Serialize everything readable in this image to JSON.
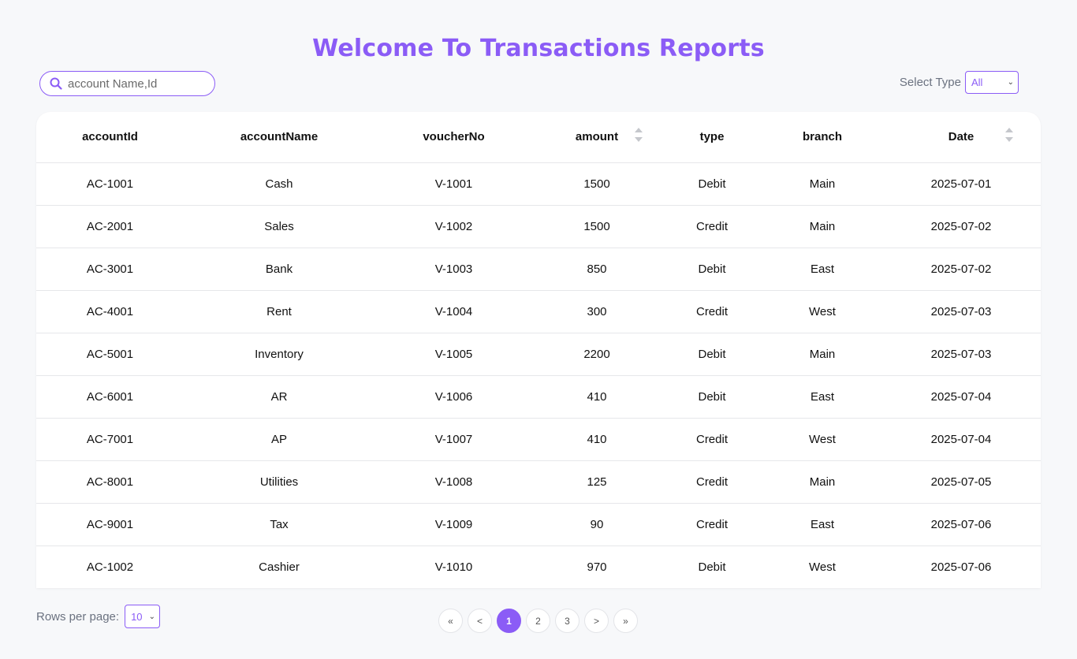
{
  "page": {
    "title": "Welcome To Transactions Reports"
  },
  "search": {
    "placeholder": "account Name,Id",
    "icon": "search-icon"
  },
  "type_filter": {
    "label": "Select Type",
    "selected": "All"
  },
  "table": {
    "columns": [
      "accountId",
      "accountName",
      "voucherNo",
      "amount",
      "type",
      "branch",
      "Date"
    ],
    "sortable_columns": [
      "amount",
      "Date"
    ],
    "rows": [
      [
        "AC-1001",
        "Cash",
        "V-1001",
        "1500",
        "Debit",
        "Main",
        "2025-07-01"
      ],
      [
        "AC-2001",
        "Sales",
        "V-1002",
        "1500",
        "Credit",
        "Main",
        "2025-07-02"
      ],
      [
        "AC-3001",
        "Bank",
        "V-1003",
        "850",
        "Debit",
        "East",
        "2025-07-02"
      ],
      [
        "AC-4001",
        "Rent",
        "V-1004",
        "300",
        "Credit",
        "West",
        "2025-07-03"
      ],
      [
        "AC-5001",
        "Inventory",
        "V-1005",
        "2200",
        "Debit",
        "Main",
        "2025-07-03"
      ],
      [
        "AC-6001",
        "AR",
        "V-1006",
        "410",
        "Debit",
        "East",
        "2025-07-04"
      ],
      [
        "AC-7001",
        "AP",
        "V-1007",
        "410",
        "Credit",
        "West",
        "2025-07-04"
      ],
      [
        "AC-8001",
        "Utilities",
        "V-1008",
        "125",
        "Credit",
        "Main",
        "2025-07-05"
      ],
      [
        "AC-9001",
        "Tax",
        "V-1009",
        "90",
        "Credit",
        "East",
        "2025-07-06"
      ],
      [
        "AC-1002",
        "Cashier",
        "V-1010",
        "970",
        "Debit",
        "West",
        "2025-07-06"
      ]
    ]
  },
  "rows_per_page": {
    "label": "Rows per page:",
    "selected": "10"
  },
  "pagination": {
    "first": "«",
    "prev": "<",
    "pages": [
      "1",
      "2",
      "3"
    ],
    "current": "1",
    "next": ">",
    "last": "»"
  },
  "colors": {
    "accent": "#8b5cf6",
    "background": "#f7f8fa"
  }
}
